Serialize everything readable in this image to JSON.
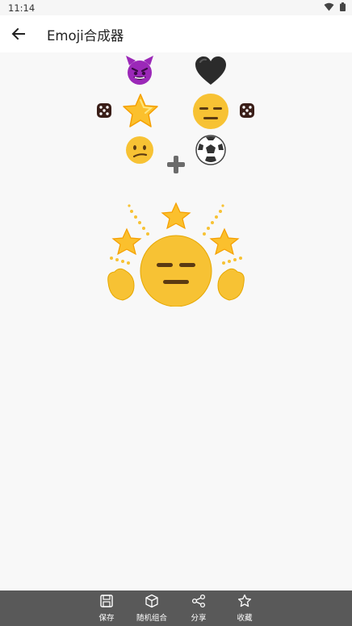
{
  "status": {
    "time": "11:14"
  },
  "appbar": {
    "title": "Emoji合成器"
  },
  "picker": {
    "left_column": [
      "smiling-imp",
      "star",
      "confused-face"
    ],
    "right_column": [
      "black-heart",
      "expressionless-face",
      "soccer-ball"
    ],
    "left_selected": "star",
    "right_selected": "expressionless-face",
    "operator": "+"
  },
  "result": {
    "combination": "star + expressionless-face"
  },
  "bottom_bar": {
    "save_label": "保存",
    "random_label": "随机组合",
    "share_label": "分享",
    "favorite_label": "收藏"
  },
  "colors": {
    "face_yellow": "#f7c234",
    "devil_purple": "#9b28b8",
    "bottom_bar_bg": "#595959"
  }
}
